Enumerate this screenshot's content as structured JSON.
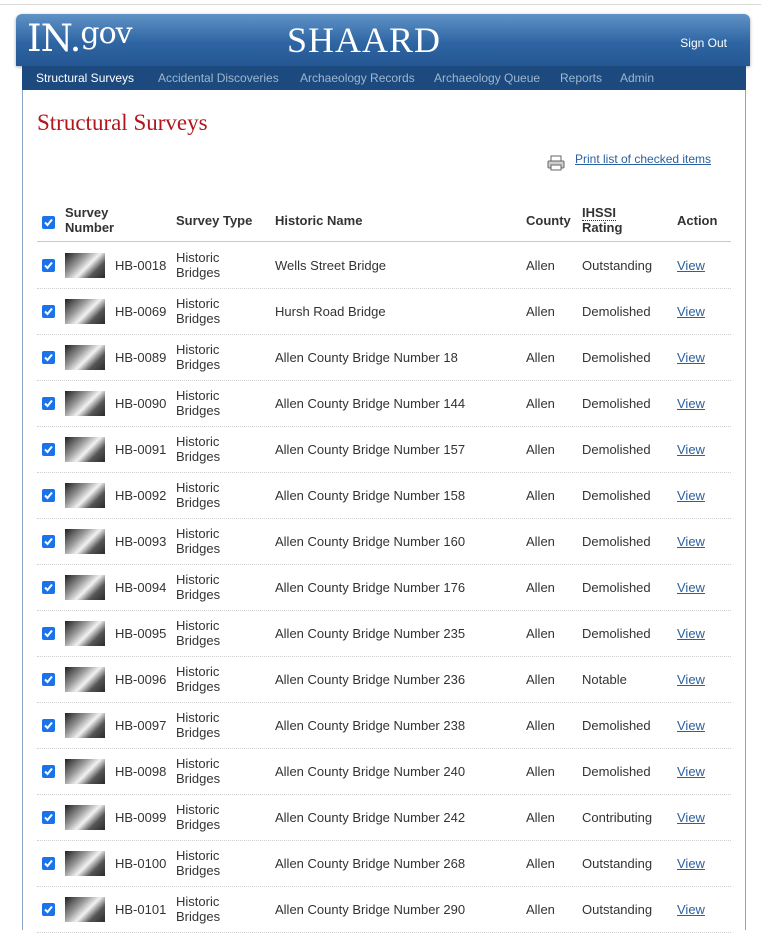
{
  "header": {
    "logo_main": "IN.",
    "logo_gov": "gov",
    "app_title": "SHAARD",
    "sign_out": "Sign Out"
  },
  "nav": {
    "items": [
      {
        "label": "Structural Surveys",
        "active": true
      },
      {
        "label": "Accidental Discoveries",
        "active": false
      },
      {
        "label": "Archaeology Records",
        "active": false
      },
      {
        "label": "Archaeology Queue",
        "active": false
      },
      {
        "label": "Reports",
        "active": false
      },
      {
        "label": "Admin",
        "active": false
      }
    ]
  },
  "page": {
    "title": "Structural Surveys",
    "print_link": "Print list of checked items"
  },
  "table": {
    "headers": {
      "survey_number": "Survey Number",
      "survey_type": "Survey Type",
      "historic_name": "Historic Name",
      "county": "County",
      "ihssi": "IHSSI",
      "rating": "Rating",
      "action": "Action"
    },
    "select_all_checked": true,
    "rows": [
      {
        "sn": "HB-0018",
        "type": "Historic Bridges",
        "name": "Wells Street Bridge",
        "county": "Allen",
        "rating": "Outstanding",
        "action": "View"
      },
      {
        "sn": "HB-0069",
        "type": "Historic Bridges",
        "name": "Hursh Road Bridge",
        "county": "Allen",
        "rating": "Demolished",
        "action": "View"
      },
      {
        "sn": "HB-0089",
        "type": "Historic Bridges",
        "name": "Allen County Bridge Number 18",
        "county": "Allen",
        "rating": "Demolished",
        "action": "View"
      },
      {
        "sn": "HB-0090",
        "type": "Historic Bridges",
        "name": "Allen County Bridge Number 144",
        "county": "Allen",
        "rating": "Demolished",
        "action": "View"
      },
      {
        "sn": "HB-0091",
        "type": "Historic Bridges",
        "name": "Allen County Bridge Number 157",
        "county": "Allen",
        "rating": "Demolished",
        "action": "View"
      },
      {
        "sn": "HB-0092",
        "type": "Historic Bridges",
        "name": "Allen County Bridge Number 158",
        "county": "Allen",
        "rating": "Demolished",
        "action": "View"
      },
      {
        "sn": "HB-0093",
        "type": "Historic Bridges",
        "name": "Allen County Bridge Number 160",
        "county": "Allen",
        "rating": "Demolished",
        "action": "View"
      },
      {
        "sn": "HB-0094",
        "type": "Historic Bridges",
        "name": "Allen County Bridge Number 176",
        "county": "Allen",
        "rating": "Demolished",
        "action": "View"
      },
      {
        "sn": "HB-0095",
        "type": "Historic Bridges",
        "name": "Allen County Bridge Number 235",
        "county": "Allen",
        "rating": "Demolished",
        "action": "View"
      },
      {
        "sn": "HB-0096",
        "type": "Historic Bridges",
        "name": "Allen County Bridge Number 236",
        "county": "Allen",
        "rating": "Notable",
        "action": "View"
      },
      {
        "sn": "HB-0097",
        "type": "Historic Bridges",
        "name": "Allen County Bridge Number 238",
        "county": "Allen",
        "rating": "Demolished",
        "action": "View"
      },
      {
        "sn": "HB-0098",
        "type": "Historic Bridges",
        "name": "Allen County Bridge Number 240",
        "county": "Allen",
        "rating": "Demolished",
        "action": "View"
      },
      {
        "sn": "HB-0099",
        "type": "Historic Bridges",
        "name": "Allen County Bridge Number 242",
        "county": "Allen",
        "rating": "Contributing",
        "action": "View"
      },
      {
        "sn": "HB-0100",
        "type": "Historic Bridges",
        "name": "Allen County Bridge Number 268",
        "county": "Allen",
        "rating": "Outstanding",
        "action": "View"
      },
      {
        "sn": "HB-0101",
        "type": "Historic Bridges",
        "name": "Allen County Bridge Number 290",
        "county": "Allen",
        "rating": "Outstanding",
        "action": "View"
      }
    ]
  },
  "colors": {
    "header_blue": "#2f65a3",
    "nav_dark": "#1c4a7f",
    "title_red": "#b0161e",
    "link_blue": "#2a5fa0",
    "checkbox_blue": "#1a73e8"
  }
}
